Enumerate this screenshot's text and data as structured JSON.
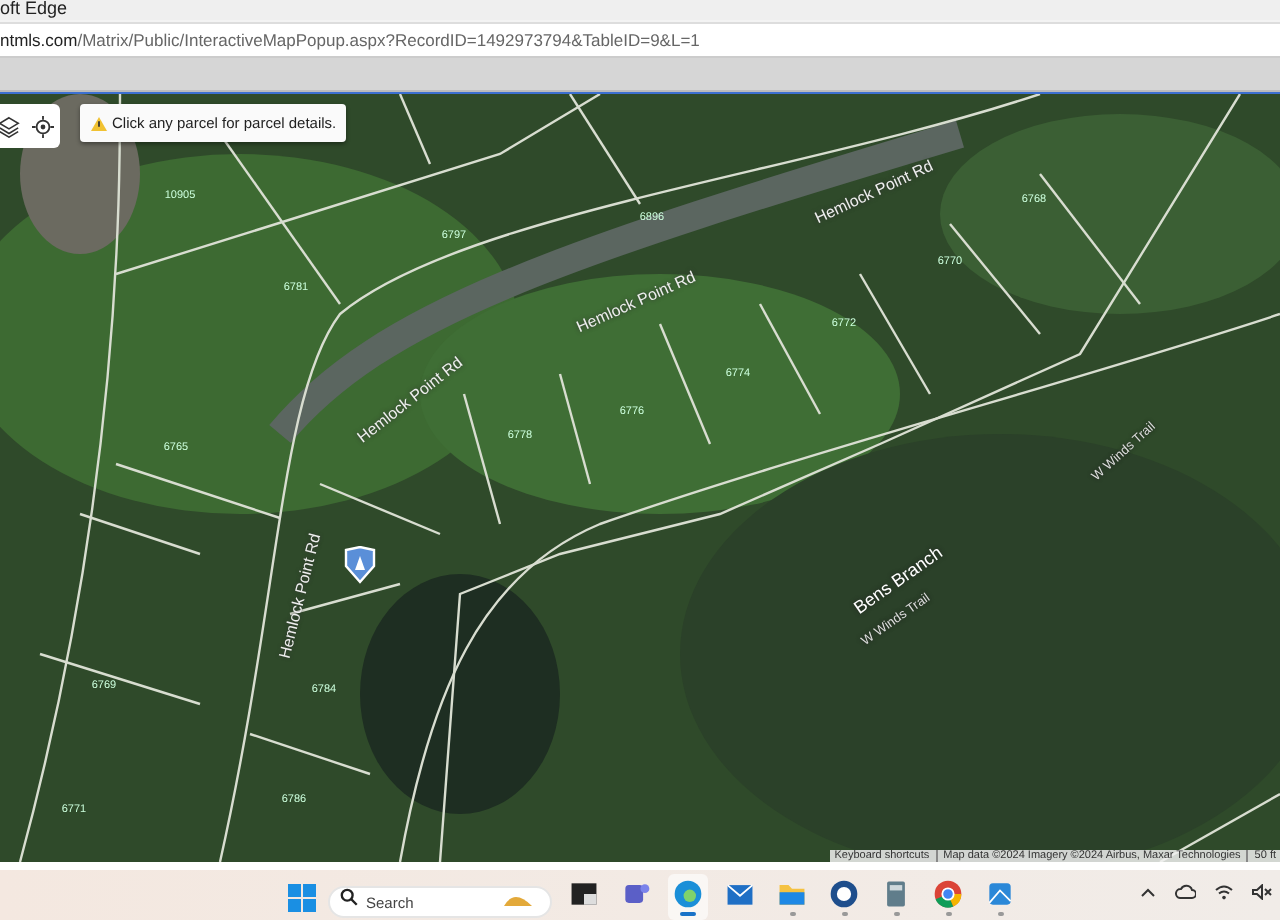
{
  "browser": {
    "title": "oft Edge",
    "url_host": "ntmls.com",
    "url_path": "/Matrix/Public/InteractiveMapPopup.aspx?RecordID=1492973794&TableID=9&L=1"
  },
  "map": {
    "notice": "Click any parcel for parcel details.",
    "labels": [
      {
        "kind": "road",
        "text": "Hemlock Point Rd"
      },
      {
        "kind": "road",
        "text": "Hemlock Point Rd"
      },
      {
        "kind": "road",
        "text": "Hemlock Point Rd"
      },
      {
        "kind": "road",
        "text": "Hemlock Point Rd"
      },
      {
        "kind": "stream",
        "text": "Bens Branch"
      },
      {
        "kind": "trail",
        "text": "W Winds Trail"
      },
      {
        "kind": "trail",
        "text": "W Winds Trail"
      },
      {
        "kind": "parcel",
        "text": "10905"
      },
      {
        "kind": "parcel",
        "text": "6797"
      },
      {
        "kind": "parcel",
        "text": "6781"
      },
      {
        "kind": "parcel",
        "text": "6896"
      },
      {
        "kind": "parcel",
        "text": "6768"
      },
      {
        "kind": "parcel",
        "text": "6770"
      },
      {
        "kind": "parcel",
        "text": "6772"
      },
      {
        "kind": "parcel",
        "text": "6774"
      },
      {
        "kind": "parcel",
        "text": "6776"
      },
      {
        "kind": "parcel",
        "text": "6778"
      },
      {
        "kind": "parcel",
        "text": "6765"
      },
      {
        "kind": "parcel",
        "text": "6769"
      },
      {
        "kind": "parcel",
        "text": "6784"
      },
      {
        "kind": "parcel",
        "text": "6786"
      },
      {
        "kind": "parcel",
        "text": "6771"
      }
    ],
    "attribution": [
      "Keyboard shortcuts",
      "Map data ©2024 Imagery ©2024 Airbus, Maxar Technologies",
      "50 ft"
    ]
  },
  "taskbar": {
    "search_placeholder": "Search",
    "apps": [
      {
        "kind": "taskview",
        "selected": false,
        "running": false
      },
      {
        "kind": "teams",
        "selected": false,
        "running": false
      },
      {
        "kind": "edge",
        "selected": true,
        "running": true
      },
      {
        "kind": "mail",
        "selected": false,
        "running": false
      },
      {
        "kind": "folder",
        "selected": false,
        "running": true
      },
      {
        "kind": "mlogo",
        "selected": false,
        "running": true
      },
      {
        "kind": "calculator",
        "selected": false,
        "running": true
      },
      {
        "kind": "chrome",
        "selected": false,
        "running": true
      },
      {
        "kind": "photo",
        "selected": false,
        "running": true
      }
    ]
  }
}
